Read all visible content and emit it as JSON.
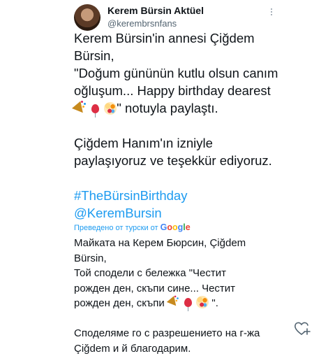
{
  "author": {
    "name": "Kerem Bürsin Aktüel",
    "handle": "@kerembrsnfans"
  },
  "tweet": {
    "line1": "Kerem Bürsin'in annesi Çiğdem",
    "line2": "Bürsin,",
    "line3": "\"Doğum gününün kutlu olsun canım",
    "line4": "oğluşum... Happy birthday dearest",
    "line5_after": "\" notuyla paylaştı.",
    "line6": "Çiğdem Hanım'ın izniyle",
    "line7": "paylaşıyoruz ve teşekkür ediyoruz.",
    "hashtag": "#TheBürsinBirthday",
    "mention": "@KeremBursin"
  },
  "translation": {
    "label": "Преведено от турски от",
    "provider": "Google",
    "line1": "Майката на Керем Бюрсин, Çiğdem",
    "line2": "Bürsin,",
    "line3": " Той сподели с бележка \"Честит",
    "line4": "рожден ден, скъпи сине... Честит",
    "line5_before": "рожден ден, скъпи ",
    "line5_after": " \".",
    "line6": " Споделяме го с разрешението на г-жа",
    "line7": "Çiğdem и й благодарим."
  },
  "icons": {
    "more": "more-vertical-icon",
    "party_popper": "party-popper-emoji",
    "balloon": "balloon-emoji",
    "confetti": "confetti-ball-emoji",
    "like": "heart-plus-icon"
  },
  "colors": {
    "link": "#1d9bf0",
    "text": "#0f1419",
    "muted": "#536471"
  }
}
